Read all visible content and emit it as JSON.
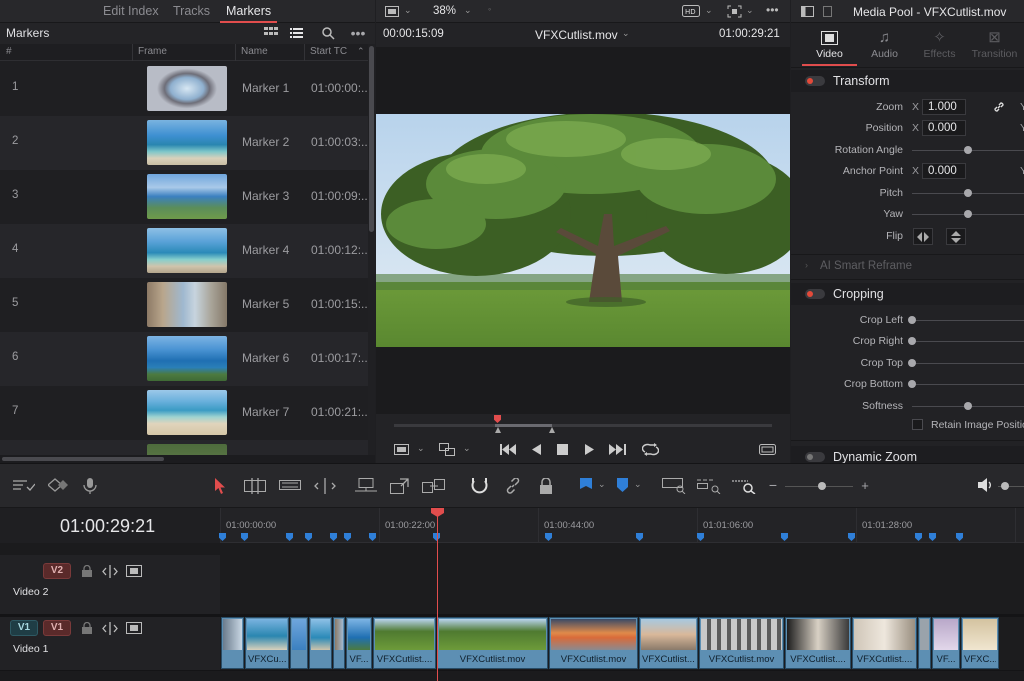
{
  "left_panel": {
    "tabs": [
      "Edit Index",
      "Tracks",
      "Markers"
    ],
    "active_tab": "Markers",
    "title": "Markers",
    "columns": [
      "#",
      "Frame",
      "Name",
      "Start TC"
    ],
    "markers": [
      {
        "num": "1",
        "name": "Marker 1",
        "tc": "01:00:00:..."
      },
      {
        "num": "2",
        "name": "Marker 2",
        "tc": "01:00:03:..."
      },
      {
        "num": "3",
        "name": "Marker 3",
        "tc": "01:00:09:..."
      },
      {
        "num": "4",
        "name": "Marker 4",
        "tc": "01:00:12:..."
      },
      {
        "num": "5",
        "name": "Marker 5",
        "tc": "01:00:15:..."
      },
      {
        "num": "6",
        "name": "Marker 6",
        "tc": "01:00:17:..."
      },
      {
        "num": "7",
        "name": "Marker 7",
        "tc": "01:00:21:..."
      }
    ]
  },
  "viewer": {
    "zoom": "38%",
    "source_tc": "00:00:15:09",
    "clip_name": "VFXCutlist.mov",
    "record_tc": "01:00:29:21"
  },
  "inspector": {
    "title": "Media Pool - VFXCutlist.mov",
    "tabs": [
      "Video",
      "Audio",
      "Effects",
      "Transition"
    ],
    "active_tab": "Video",
    "transform": {
      "title": "Transform",
      "zoom_label": "Zoom",
      "zoom_x": "1.000",
      "position_label": "Position",
      "position_x": "0.000",
      "rotation_label": "Rotation Angle",
      "anchor_label": "Anchor Point",
      "anchor_x": "0.000",
      "pitch_label": "Pitch",
      "yaw_label": "Yaw",
      "flip_label": "Flip",
      "x_label": "X",
      "y_label": "Y"
    },
    "smart_reframe": "AI Smart Reframe",
    "cropping": {
      "title": "Cropping",
      "left": "Crop Left",
      "right": "Crop Right",
      "top": "Crop Top",
      "bottom": "Crop Bottom",
      "softness": "Softness",
      "retain": "Retain Image Position"
    },
    "dynamic_zoom": "Dynamic Zoom"
  },
  "timeline": {
    "timecode": "01:00:29:21",
    "ruler_labels": [
      "01:00:00:00",
      "01:00:22:00",
      "01:00:44:00",
      "01:01:06:00",
      "01:01:28:00"
    ],
    "tracks": {
      "v2": {
        "badge": "V2",
        "name": "Video 2"
      },
      "v1": {
        "badge_src": "V1",
        "badge": "V1",
        "name": "Video 1"
      }
    },
    "clips": [
      "",
      "VFXCu...",
      "",
      "",
      "",
      "VF...",
      "VFXCutlist....",
      "VFXCutlist.mov",
      "VFXCutlist.mov",
      "VFXCutlist....",
      "VFXCutlist.mov",
      "VFXCutlist....",
      "VFXCutlist....",
      "VF...",
      "VFXC..."
    ]
  },
  "colors": {
    "accent_red": "#e14d4d",
    "marker_blue": "#2f7fd8",
    "clip_blue": "#5d8fb3"
  }
}
